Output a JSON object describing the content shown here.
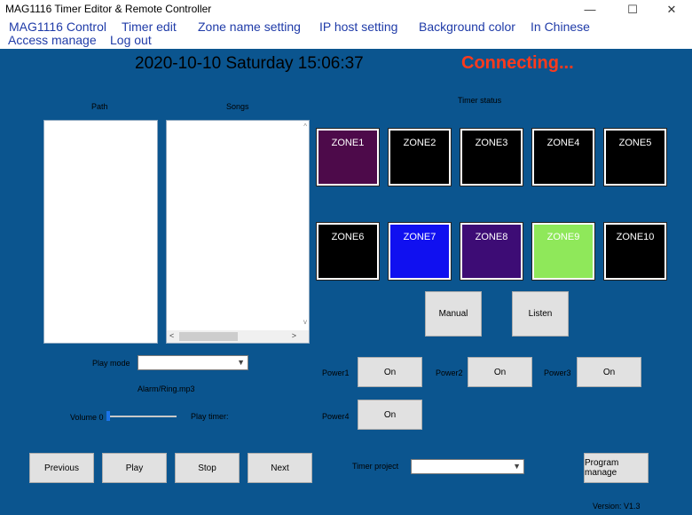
{
  "window": {
    "title": "MAG1116 Timer Editor & Remote Controller",
    "minimize": "—",
    "maximize": "☐",
    "close": "✕"
  },
  "menu": {
    "items": [
      "MAG1116 Control",
      "Timer edit",
      "Zone name setting",
      "IP host setting",
      "Background color",
      "In Chinese",
      "Access manage",
      "Log out"
    ]
  },
  "header": {
    "datetime": "2020-10-10  Saturday  15:06:37",
    "status": "Connecting...",
    "status_color": "#ff3a1c"
  },
  "lists": {
    "path_label": "Path",
    "songs_label": "Songs",
    "scroll_left": "<",
    "scroll_right": ">",
    "scroll_up": "^",
    "scroll_down": "v"
  },
  "timer_status": {
    "label": "Timer status",
    "zones": [
      {
        "name": "ZONE1",
        "color": "#4d0a4a"
      },
      {
        "name": "ZONE2",
        "color": "#000000"
      },
      {
        "name": "ZONE3",
        "color": "#000000"
      },
      {
        "name": "ZONE4",
        "color": "#000000"
      },
      {
        "name": "ZONE5",
        "color": "#000000"
      },
      {
        "name": "ZONE6",
        "color": "#000000"
      },
      {
        "name": "ZONE7",
        "color": "#1010f0"
      },
      {
        "name": "ZONE8",
        "color": "#3d0c75"
      },
      {
        "name": "ZONE9",
        "color": "#8fe85a"
      },
      {
        "name": "ZONE10",
        "color": "#000000"
      }
    ]
  },
  "controls": {
    "manual": "Manual",
    "listen": "Listen",
    "play_mode_label": "Play mode",
    "play_mode_value": "",
    "current_file": "Alarm/Ring.mp3",
    "volume_label": "Volume 0",
    "volume_level": 0,
    "play_timer_label": "Play timer:",
    "previous": "Previous",
    "play": "Play",
    "stop": "Stop",
    "next": "Next"
  },
  "power": {
    "items": [
      {
        "label": "Power1",
        "button": "On"
      },
      {
        "label": "Power2",
        "button": "On"
      },
      {
        "label": "Power3",
        "button": "On"
      },
      {
        "label": "Power4",
        "button": "On"
      }
    ]
  },
  "timer_project": {
    "label": "Timer project",
    "value": ""
  },
  "program_manage": "Program manage",
  "version": "Version: V1.3"
}
